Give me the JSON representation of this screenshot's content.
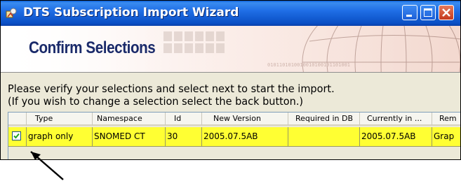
{
  "window": {
    "title": "DTS Subscription Import Wizard",
    "title_icon": "app-icon",
    "titlebar_color": "#1f6ee6",
    "close_color": "#c5391d"
  },
  "banner": {
    "title": "Confirm Selections",
    "title_color": "#1a2a6a"
  },
  "instructions": {
    "line1": "Please verify your selections and select next to start the import.",
    "line2": "(If you wish to change a selection select the back button.)"
  },
  "table": {
    "columns": [
      "Type",
      "Namespace",
      "Id",
      "New Version",
      "Required in DB",
      "Currently in ...",
      "Rem"
    ],
    "rows": [
      {
        "checked": true,
        "type": "graph only",
        "namespace": "SNOMED CT",
        "id": "30",
        "new_version": "2005.07.5AB",
        "required_in_db": "",
        "currently_in": "2005.07.5AB",
        "rem": "Grap"
      }
    ],
    "highlight_color": "#ffff33"
  }
}
